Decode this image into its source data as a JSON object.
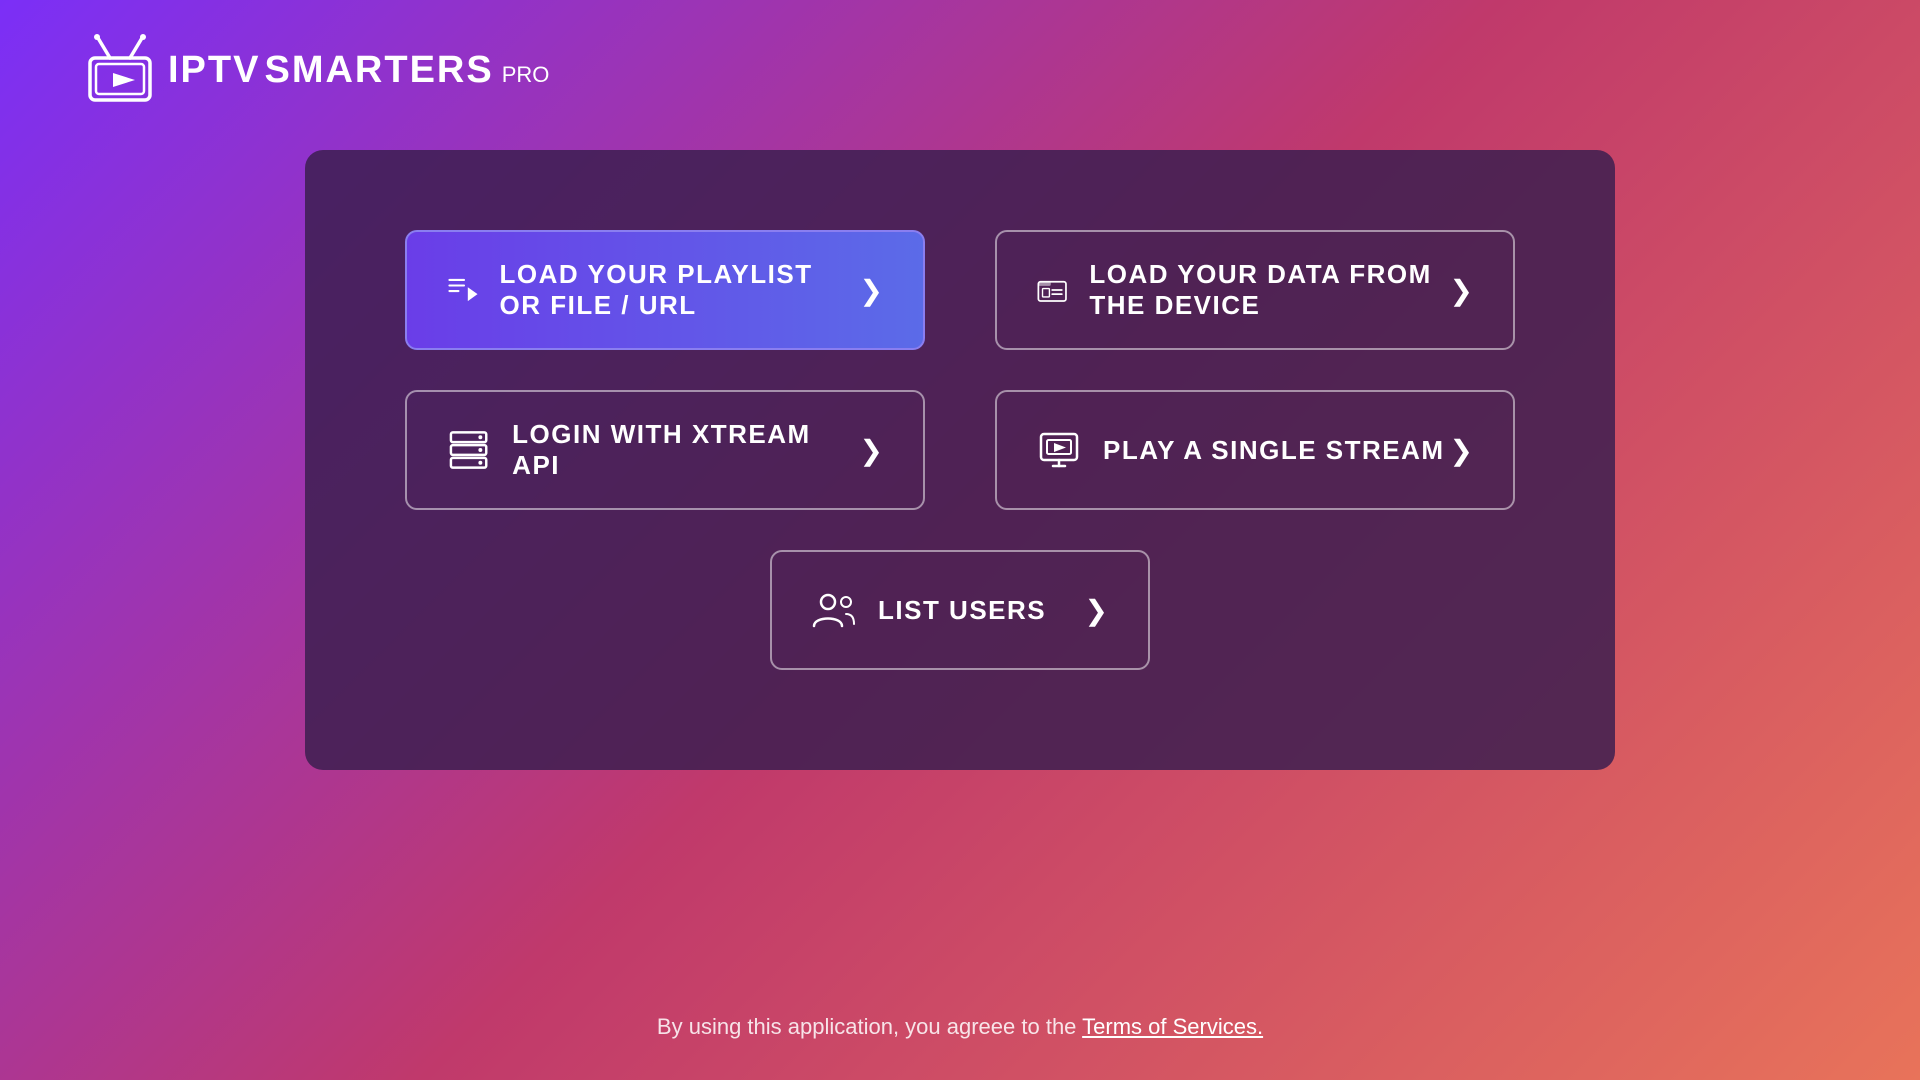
{
  "app": {
    "name_iptv": "IPTV",
    "name_smarters": "SMARTERS",
    "name_pro": "PRO"
  },
  "buttons": {
    "playlist": {
      "label": "LOAD YOUR PLAYLIST OR FILE / URL",
      "arrow": "›"
    },
    "device": {
      "label": "LOAD YOUR DATA FROM THE DEVICE",
      "arrow": "›"
    },
    "xtream": {
      "label": "LOGIN WITH XTREAM API",
      "arrow": "›"
    },
    "stream": {
      "label": "PLAY A SINGLE STREAM",
      "arrow": "›"
    },
    "users": {
      "label": "LIST USERS",
      "arrow": "›"
    }
  },
  "footer": {
    "text_before": "By using this application, you agreee to the",
    "link_text": "Terms of Services."
  }
}
